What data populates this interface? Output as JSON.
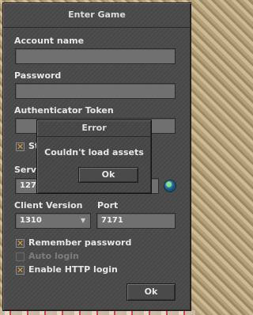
{
  "window": {
    "title": "Enter Game"
  },
  "account": {
    "label": "Account name",
    "value": ""
  },
  "password": {
    "label": "Password",
    "value": ""
  },
  "authenticator": {
    "label": "Authenticator Token",
    "value": ""
  },
  "stay_logged": {
    "label_visible": "St",
    "checked": true
  },
  "server": {
    "label_visible": "Serv",
    "value_visible": "127."
  },
  "client_version": {
    "label": "Client Version",
    "value": "1310"
  },
  "port": {
    "label": "Port",
    "value": "7171"
  },
  "remember_password": {
    "label": "Remember password",
    "checked": true
  },
  "auto_login": {
    "label": "Auto login",
    "checked": false,
    "enabled": false
  },
  "enable_http": {
    "label": "Enable HTTP login",
    "checked": true
  },
  "ok_button": {
    "label": "Ok"
  },
  "error_dialog": {
    "title": "Error",
    "message": "Couldn't load assets",
    "ok_label": "Ok"
  },
  "icons": {
    "check": "✕",
    "dropdown": "▼",
    "globe": "globe-icon"
  }
}
